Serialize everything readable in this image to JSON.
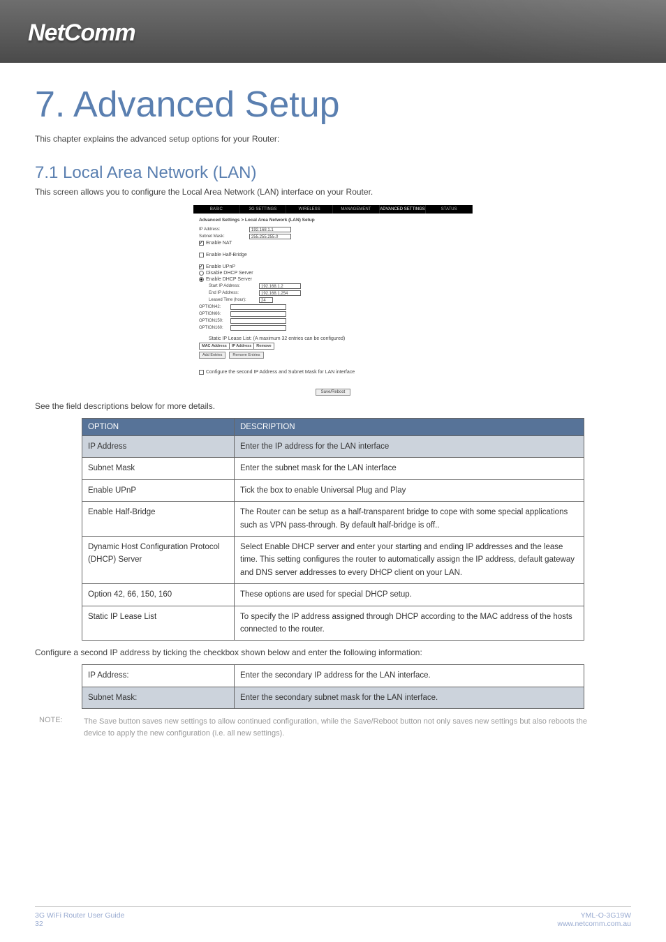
{
  "brand": "NetComm",
  "page_title": "7. Advanced Setup",
  "intro": "This chapter explains the advanced setup options for your Router:",
  "section_title": "7.1 Local Area Network (LAN)",
  "section_intro": "This screen allows you to configure the Local Area Network (LAN) interface on your Router.",
  "screenshot": {
    "tabs": [
      "BASIC",
      "3G SETTINGS",
      "WIRELESS",
      "MANAGEMENT",
      "ADVANCED SETTINGS",
      "STATUS"
    ],
    "heading": "Advanced Settings > Local Area Network (LAN) Setup",
    "ip_label": "IP Address:",
    "ip_value": "192.168.1.1",
    "mask_label": "Subnet Mask:",
    "mask_value": "255.255.255.0",
    "enable_nat": "Enable NAT",
    "enable_half": "Enable Half-Bridge",
    "enable_upnp": "Enable UPnP",
    "disable_dhcp": "Disable DHCP Server",
    "enable_dhcp": "Enable DHCP Server",
    "start_ip_label": "Start IP Address:",
    "start_ip_value": "192.168.1.2",
    "end_ip_label": "End IP Address:",
    "end_ip_value": "192.168.1.254",
    "lease_label": "Leased Time (hour):",
    "lease_value": "24",
    "opt42": "OPTION42:",
    "opt66": "OPTION66:",
    "opt150": "OPTION150:",
    "opt160": "OPTION160:",
    "lease_list": "Static IP Lease List: (A maximum 32 entries can be configured)",
    "th_mac": "MAC Address",
    "th_ip": "IP Address",
    "th_rm": "Remove",
    "btn_add": "Add Entries",
    "btn_remove": "Remove Entries",
    "second_ip": "Configure the second IP Address and Subnet Mask for LAN interface",
    "save_btn": "Save/Reboot"
  },
  "see_fields": "See the field descriptions below for more details.",
  "table1": {
    "h1": "OPTION",
    "h2": "DESCRIPTION",
    "r0a": "IP Address",
    "r0b": "Enter the IP address for the LAN interface",
    "r1a": "Subnet Mask",
    "r1b": "Enter the subnet mask for the LAN interface",
    "r2a": "Enable UPnP",
    "r2b": "Tick the box to enable Universal Plug and Play",
    "r3a": "Enable Half-Bridge",
    "r3b": "The Router can be setup as a half-transparent bridge to cope with some special applications such as VPN pass-through. By default half-bridge is off..",
    "r4a": "Dynamic Host Configuration Protocol (DHCP) Server",
    "r4b": "Select Enable DHCP server and enter your starting and ending IP addresses and the lease time. This setting configures the router to automatically assign the IP address, default gateway and DNS server addresses to every  DHCP client on your LAN.",
    "r5a": "Option 42, 66, 150, 160",
    "r5b": "These options are used for special DHCP setup.",
    "r6a": "Static IP Lease List",
    "r6b": "To specify the IP address assigned through DHCP according to the MAC address of the hosts connected to the router."
  },
  "configure_text": "Configure a second IP address by ticking the checkbox shown below and enter the following information:",
  "table2": {
    "r0a": "IP Address:",
    "r0b": "Enter the secondary IP address for the LAN interface.",
    "r1a": "Subnet Mask:",
    "r1b": "Enter the secondary subnet mask for the LAN interface."
  },
  "note_label": "NOTE:",
  "note_text": "The Save button saves new settings to allow continued configuration, while the Save/Reboot button not only saves new settings but also reboots the device to apply the new configuration (i.e. all new settings).",
  "footer": {
    "left1": "3G WiFi Router User Guide",
    "left2": "32",
    "right1": "YML-O-3G19W",
    "right2": "www.netcomm.com.au"
  }
}
